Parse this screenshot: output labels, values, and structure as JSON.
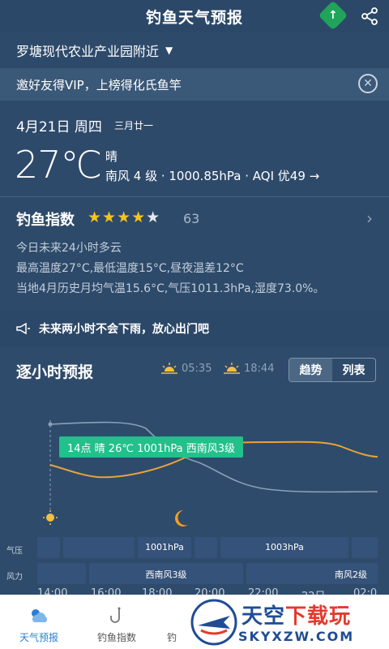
{
  "header": {
    "title": "钓鱼天气预报",
    "gift_badge": "↑",
    "icons": [
      "gift-icon",
      "share-icon"
    ]
  },
  "location": {
    "name": "罗塘现代农业产业园附近",
    "caret": "▼"
  },
  "vip_banner": {
    "text": "邀好友得VIP，上榜得化氏鱼竿",
    "close": "✕"
  },
  "today": {
    "date": "4月21日 周四",
    "lunar": "三月廿一",
    "temperature": "27℃",
    "condition": "晴",
    "detail": "南风 4 级 · 1000.85hPa · AQI 优49 →"
  },
  "fishing_index": {
    "label": "钓鱼指数",
    "stars_filled": "★★★★",
    "stars_empty": "★",
    "rating": 4,
    "score": "63",
    "chevron": "›",
    "lines": [
      "今日未来24小时多云",
      "最高温度27°C,最低温度15°C,昼夜温差12°C",
      "当地4月历史月均气温15.6°C,气压1011.3hPa,湿度73.0%。"
    ]
  },
  "rain_notice": {
    "icon": "megaphone-icon",
    "text": "未来两小时不会下雨，放心出门吧"
  },
  "hourly": {
    "title": "逐小时预报",
    "sunrise": "05:35",
    "sunset": "18:44",
    "toggle": [
      "趋势",
      "列表"
    ],
    "active_toggle": "趋势",
    "tooltip": "14点 晴 26℃ 1001hPa 西南风3级",
    "row_labels": {
      "pressure": "气压",
      "wind": "风力"
    },
    "pressure_cells": [
      "1001hPa",
      "1003hPa"
    ],
    "wind_cells": [
      "西南风3级",
      "南风2级"
    ],
    "times": [
      "14:00",
      "16:00",
      "18:00",
      "20:00",
      "22:00",
      "22日",
      "02:0"
    ],
    "colors": {
      "temperature_line": "#e8a23a",
      "pressure_line": "#8aa0b8",
      "tooltip": "#22c08a"
    }
  },
  "tabbar": {
    "tabs": [
      {
        "label": "天气预报",
        "icon": "weather-icon",
        "active": true
      },
      {
        "label": "钓鱼指数",
        "icon": "fishing-hook-icon",
        "active": false
      },
      {
        "label": "钓",
        "icon": "tab-icon",
        "active": false
      }
    ]
  },
  "watermark": {
    "text_main": "天空",
    "text_red": "下载玩",
    "url": "SKYXZW.COM"
  }
}
